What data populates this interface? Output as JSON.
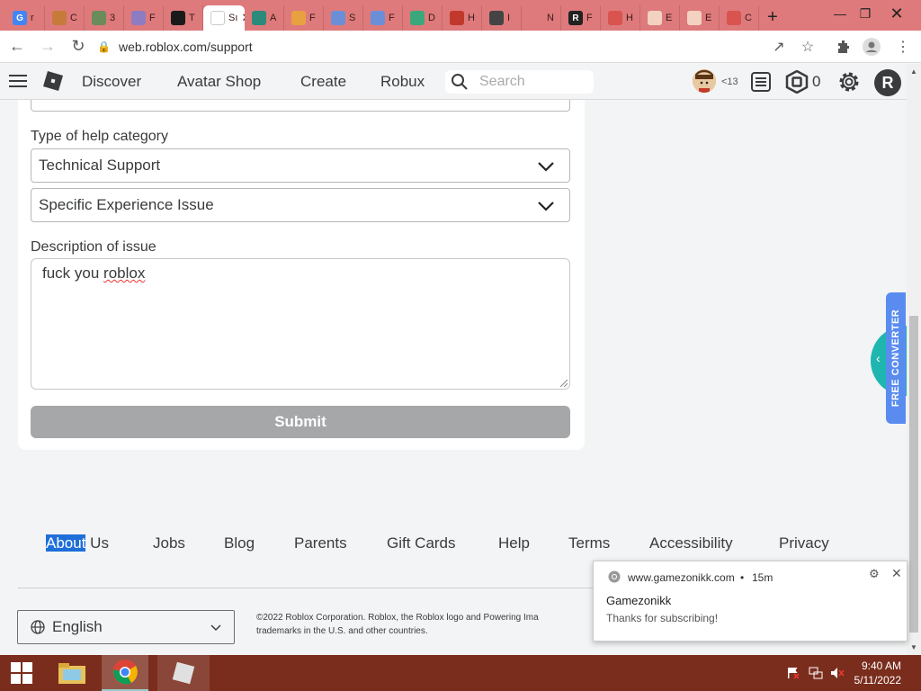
{
  "browser": {
    "tabs": [
      {
        "label": "r",
        "color": "#4285f4",
        "fav": "G"
      },
      {
        "label": "C",
        "color": "#c67b3a",
        "fav": ""
      },
      {
        "label": "3",
        "color": "#6a8c5a",
        "fav": ""
      },
      {
        "label": "F",
        "color": "#8e7cc3",
        "fav": ""
      },
      {
        "label": "T",
        "color": "#1a1a1a",
        "fav": ""
      },
      {
        "label": "Sı",
        "color": "#ffffff",
        "fav": "",
        "active": true
      },
      {
        "label": "A",
        "color": "#2c8a7a",
        "fav": ""
      },
      {
        "label": "F",
        "color": "#e8a040",
        "fav": ""
      },
      {
        "label": "S",
        "color": "#6b8fd6",
        "fav": ""
      },
      {
        "label": "F",
        "color": "#6b8fd6",
        "fav": ""
      },
      {
        "label": "D",
        "color": "#3aa87a",
        "fav": ""
      },
      {
        "label": "H",
        "color": "#c0392b",
        "fav": ""
      },
      {
        "label": "I",
        "color": "#444444",
        "fav": ""
      },
      {
        "label": "N",
        "color": "#de7a7b",
        "fav": ""
      },
      {
        "label": "F",
        "color": "#222222",
        "fav": "R"
      },
      {
        "label": "H",
        "color": "#d9534f",
        "fav": ""
      },
      {
        "label": "E",
        "color": "#f3d2c1",
        "fav": ""
      },
      {
        "label": "E",
        "color": "#f3d2c1",
        "fav": ""
      },
      {
        "label": "C",
        "color": "#d9534f",
        "fav": ""
      }
    ],
    "url": "web.roblox.com/support"
  },
  "roblox_nav": {
    "links": [
      "Discover",
      "Avatar Shop",
      "Create",
      "Robux"
    ],
    "search_placeholder": "Search",
    "age_badge": "<13",
    "robux_count": "0"
  },
  "form": {
    "help_category_label": "Type of help category",
    "category_value": "Technical Support",
    "subcategory_value": "Specific Experience Issue",
    "description_label": "Description of issue",
    "description_word1": "fuck you ",
    "description_word2": "roblox",
    "submit_label": "Submit"
  },
  "footer": {
    "links": [
      "About Us",
      "Jobs",
      "Blog",
      "Parents",
      "Gift Cards",
      "Help",
      "Terms",
      "Accessibility",
      "Privacy"
    ],
    "about_highlight": "About",
    "about_rest": " Us",
    "language": "English",
    "copyright_line1": "©2022 Roblox Corporation. Roblox, the Roblox logo and Powering Ima",
    "copyright_line2": "trademarks in the U.S. and other countries."
  },
  "notification": {
    "site": "www.gamezonikk.com",
    "time": "15m",
    "title": "Gamezonikk",
    "body": "Thanks for subscribing!"
  },
  "side_widget": {
    "label": "FREE CONVERTER"
  },
  "taskbar": {
    "time": "9:40 AM",
    "date": "5/11/2022"
  }
}
